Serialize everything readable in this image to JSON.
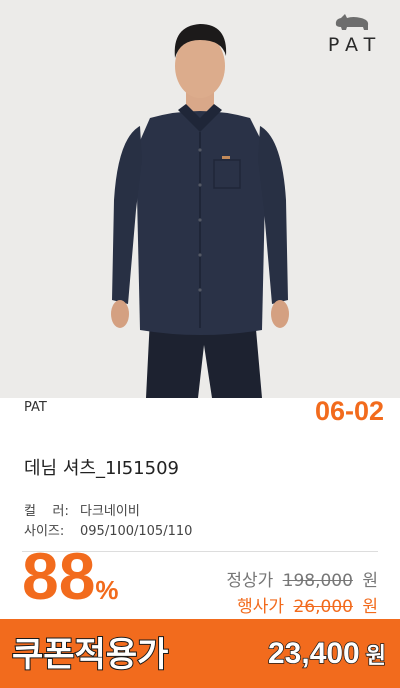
{
  "brand_logo": {
    "text": "PAT",
    "icon": "rhino-icon"
  },
  "date_code": "06-02",
  "product": {
    "brand": "PAT",
    "name": "데님 셔츠_1I51509",
    "color_label": "컬    러:",
    "color_value": "다크네이비",
    "size_label": "사이즈:",
    "size_value": "095/100/105/110"
  },
  "pricing": {
    "discount_value": "88",
    "discount_unit": "%",
    "regular_label": "정상가",
    "regular_price": "198,000",
    "regular_unit": "원",
    "event_label": "행사가",
    "event_price": "26,000",
    "event_unit": "원",
    "coupon_label": "쿠폰적용가",
    "coupon_price": "23,400",
    "coupon_unit": "원"
  },
  "colors": {
    "accent": "#f26b1d",
    "shirt": "#2a3247",
    "background": "#ecebe9"
  }
}
